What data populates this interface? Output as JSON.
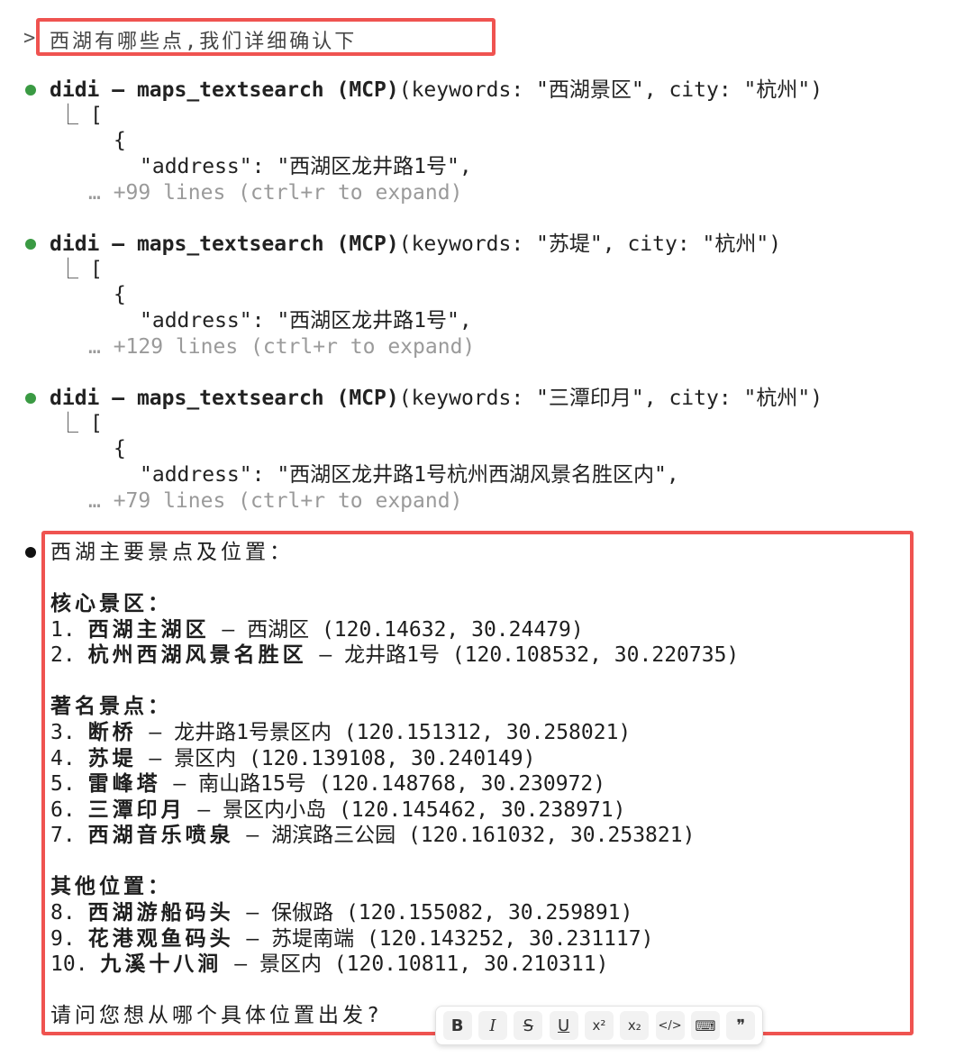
{
  "prompt": {
    "caret": ">",
    "text": "西湖有哪些点,我们详细确认下"
  },
  "tool_calls": [
    {
      "server": "didi",
      "dash": " – ",
      "tool": "maps_textsearch (MCP)",
      "args": "(keywords: \"西湖景区\", city: \"杭州\")",
      "bracket": "[",
      "brace": "{",
      "address_line": "\"address\": \"西湖区龙井路1号\",",
      "collapsed": "… +99 lines (ctrl+r to expand)"
    },
    {
      "server": "didi",
      "dash": " – ",
      "tool": "maps_textsearch (MCP)",
      "args": "(keywords: \"苏堤\", city: \"杭州\")",
      "bracket": "[",
      "brace": "{",
      "address_line": "\"address\": \"西湖区龙井路1号\",",
      "collapsed": "… +129 lines (ctrl+r to expand)"
    },
    {
      "server": "didi",
      "dash": " – ",
      "tool": "maps_textsearch (MCP)",
      "args": "(keywords: \"三潭印月\", city: \"杭州\")",
      "bracket": "[",
      "brace": "{",
      "address_line": "\"address\": \"西湖区龙井路1号杭州西湖风景名胜区内\",",
      "collapsed": "… +79 lines (ctrl+r to expand)"
    }
  ],
  "answer": {
    "intro": "西湖主要景点及位置：",
    "sections": [
      {
        "heading": "核心景区：",
        "items": [
          {
            "num": "1.",
            "name": "西湖主湖区",
            "rest": " – 西湖区 (120.14632, 30.24479)"
          },
          {
            "num": "2.",
            "name": "杭州西湖风景名胜区",
            "rest": " – 龙井路1号 (120.108532, 30.220735)"
          }
        ]
      },
      {
        "heading": "著名景点：",
        "items": [
          {
            "num": "3.",
            "name": "断桥",
            "rest": " – 龙井路1号景区内 (120.151312, 30.258021)"
          },
          {
            "num": "4.",
            "name": "苏堤",
            "rest": " – 景区内 (120.139108, 30.240149)"
          },
          {
            "num": "5.",
            "name": "雷峰塔",
            "rest": " – 南山路15号 (120.148768, 30.230972)"
          },
          {
            "num": "6.",
            "name": "三潭印月",
            "rest": " – 景区内小岛 (120.145462, 30.238971)"
          },
          {
            "num": "7.",
            "name": "西湖音乐喷泉",
            "rest": " – 湖滨路三公园 (120.161032, 30.253821)"
          }
        ]
      },
      {
        "heading": "其他位置：",
        "items": [
          {
            "num": "8.",
            "name": "西湖游船码头",
            "rest": " – 保俶路 (120.155082, 30.259891)"
          },
          {
            "num": "9.",
            "name": "花港观鱼码头",
            "rest": " – 苏堤南端 (120.143252, 30.231117)"
          },
          {
            "num": "10.",
            "name": "九溪十八涧",
            "rest": " – 景区内 (120.10811, 30.210311)"
          }
        ]
      }
    ],
    "question": "请问您想从哪个具体位置出发?"
  },
  "toolbar": {
    "bold": "B",
    "italic": "I",
    "strike": "S",
    "underline": "U",
    "superscript": "x²",
    "subscript": "x₂",
    "code": "</>",
    "code_block": "⌨",
    "quote": "❞"
  },
  "colors": {
    "highlight_border": "#ef5350",
    "tool_dot": "#3a9a43",
    "answer_dot": "#111111",
    "muted_text": "#9a9a9a"
  }
}
